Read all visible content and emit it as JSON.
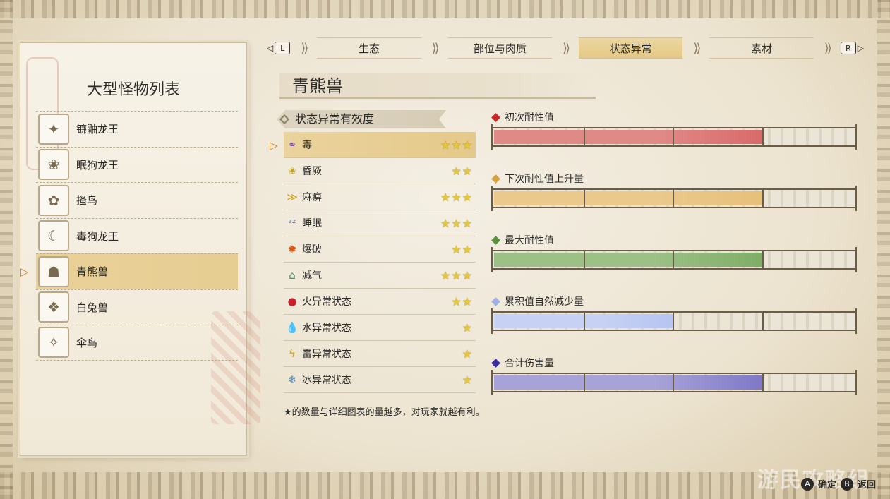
{
  "tabs": {
    "left_key": "L",
    "right_key": "R",
    "items": [
      "生态",
      "部位与肉质",
      "状态异常",
      "素材"
    ],
    "active": "状态异常"
  },
  "monster_list": {
    "title": "大型怪物列表",
    "items": [
      "镰鼬龙王",
      "眠狗龙王",
      "搔鸟",
      "毒狗龙王",
      "青熊兽",
      "白兔兽",
      "伞鸟"
    ],
    "selected": "青熊兽"
  },
  "monster": {
    "name": "青熊兽"
  },
  "effectiveness": {
    "title": "状态异常有效度",
    "rows": [
      {
        "icon": "poison-icon",
        "label": "毒",
        "stars": "★★★"
      },
      {
        "icon": "stun-icon",
        "label": "昏厥",
        "stars": "★★"
      },
      {
        "icon": "paralysis-icon",
        "label": "麻痹",
        "stars": "★★★"
      },
      {
        "icon": "sleep-icon",
        "label": "睡眠",
        "stars": "★★★"
      },
      {
        "icon": "blast-icon",
        "label": "爆破",
        "stars": "★★"
      },
      {
        "icon": "exhaust-icon",
        "label": "减气",
        "stars": "★★★"
      },
      {
        "icon": "fireblight-icon",
        "label": "火异常状态",
        "stars": "★★"
      },
      {
        "icon": "waterblight-icon",
        "label": "水异常状态",
        "stars": "★"
      },
      {
        "icon": "thunderblight-icon",
        "label": "雷异常状态",
        "stars": "★"
      },
      {
        "icon": "iceblight-icon",
        "label": "冰异常状态",
        "stars": "★"
      }
    ],
    "footnote": "★的数量与详细图表的量越多，对玩家就越有利。"
  },
  "bars": [
    {
      "label": "初次耐性值",
      "color": "#c9282a",
      "fill_color": "#e08a88",
      "fill_dark": "#d96a6a",
      "level": 3
    },
    {
      "label": "下次耐性值上升量",
      "color": "#d8a13d",
      "fill_color": "#ebc98c",
      "fill_dark": "#e7c07a",
      "level": 3
    },
    {
      "label": "最大耐性值",
      "color": "#5a8f3e",
      "fill_color": "#9cc086",
      "fill_dark": "#7eae66",
      "level": 3
    },
    {
      "label": "累积值自然减少量",
      "color": "#9fb0e6",
      "fill_color": "#c6d1f3",
      "fill_dark": "#b6c5f1",
      "level": 2
    },
    {
      "label": "合计伤害量",
      "color": "#3a2f9a",
      "fill_color": "#a7a3d8",
      "fill_dark": "#7f78c8",
      "level": 3
    }
  ],
  "bar_segments": 4,
  "footer": {
    "confirm_key": "A",
    "confirm": "确定",
    "back_key": "B",
    "back": "返回",
    "brand": "游民攻略组"
  }
}
